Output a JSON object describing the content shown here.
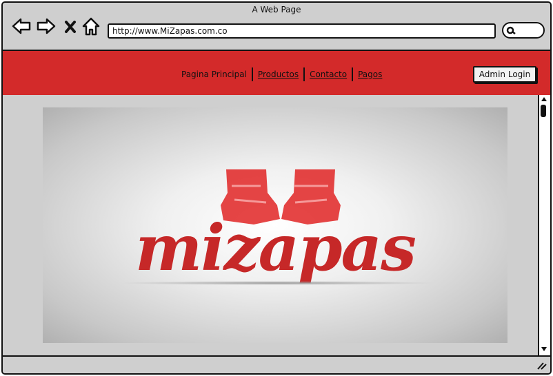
{
  "window": {
    "title": "A Web Page"
  },
  "browser": {
    "url": "http://www.MiZapas.com.co",
    "back_icon": "back-arrow-icon",
    "forward_icon": "forward-arrow-icon",
    "close_icon": "close-x-icon",
    "home_icon": "home-icon",
    "search_icon": "magnifier-icon"
  },
  "header": {
    "bg_color": "#d32a2a",
    "nav": [
      {
        "label": "Pagina Principal",
        "link": false
      },
      {
        "label": "Productos",
        "link": true
      },
      {
        "label": "Contacto",
        "link": true
      },
      {
        "label": "Pagos",
        "link": true
      }
    ],
    "admin_label": "Admin Login"
  },
  "banner": {
    "logo_text": "mizapas",
    "logo_color": "#c62828",
    "image_icon": "shoes-icon"
  }
}
